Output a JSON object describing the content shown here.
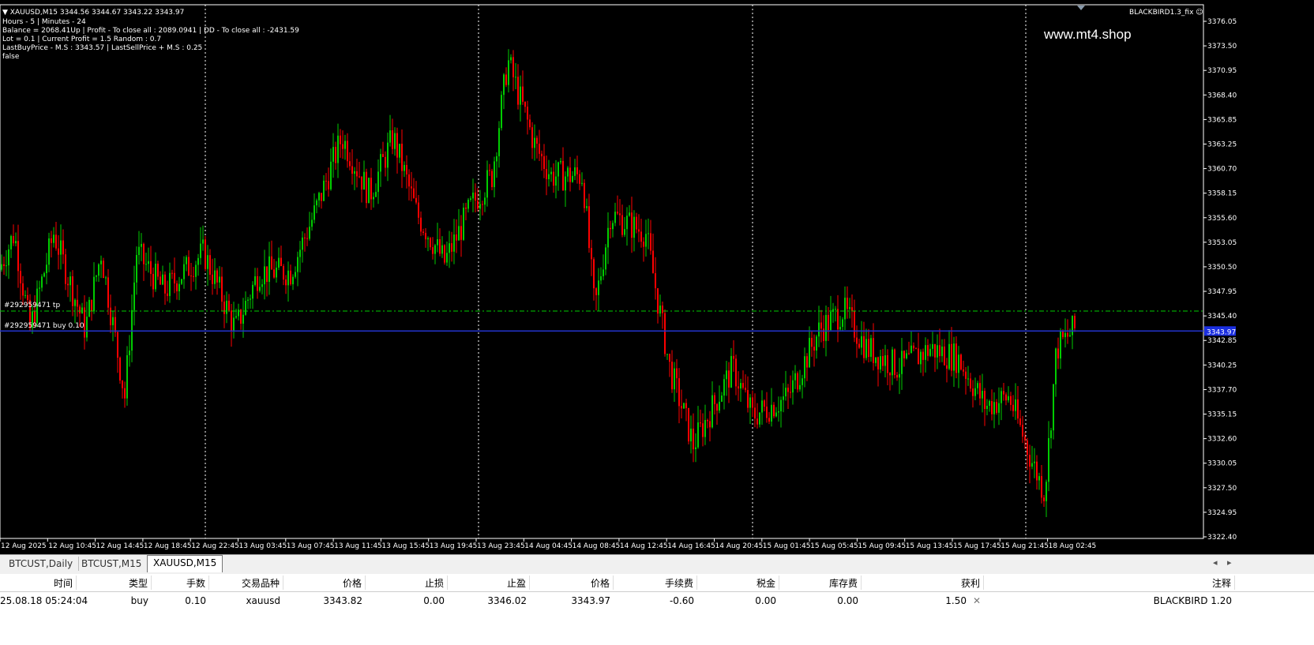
{
  "chart": {
    "header": "XAUUSD,M15  3344.56 3344.67 3343.22 3343.97",
    "info_lines": [
      "Hours - 5 | Minutes - 24",
      "Balance = 2068.41Up | Profit - To close all : 2089.0941 | DD - To close all : -2431.59",
      "Lot = 0.1 | Current Profit = 1.5 Random : 0.7",
      "LastBuyPrice - M.S : 3343.57 | LastSellPrice + M.S : 0.25",
      "false"
    ],
    "ea_name": "BLACKBIRD1.3_fix",
    "watermark": "www.mt4.shop",
    "tp_label": "#292959471 tp",
    "buy_label": "#292959471 buy 0.10",
    "current_price_label": "3343.97",
    "tp_price": 3345.9,
    "buy_price": 3343.82,
    "colors": {
      "bull": "#00cc00",
      "bear": "#ff0000",
      "background": "#000000",
      "buy_line": "#2233cc",
      "tp_line": "#00cc00"
    }
  },
  "price_axis": {
    "ticks": [
      "3376.05",
      "3373.50",
      "3370.95",
      "3368.40",
      "3365.85",
      "3363.25",
      "3360.70",
      "3358.15",
      "3355.60",
      "3353.05",
      "3350.50",
      "3347.95",
      "3345.40",
      "3342.85",
      "3340.25",
      "3337.70",
      "3335.15",
      "3332.60",
      "3330.05",
      "3327.50",
      "3324.95",
      "3322.40"
    ]
  },
  "time_axis": {
    "ticks": [
      "12 Aug 2025",
      "12 Aug 10:45",
      "12 Aug 14:45",
      "12 Aug 18:45",
      "12 Aug 22:45",
      "13 Aug 03:45",
      "13 Aug 07:45",
      "13 Aug 11:45",
      "13 Aug 15:45",
      "13 Aug 19:45",
      "13 Aug 23:45",
      "14 Aug 04:45",
      "14 Aug 08:45",
      "14 Aug 12:45",
      "14 Aug 16:45",
      "14 Aug 20:45",
      "15 Aug 01:45",
      "15 Aug 05:45",
      "15 Aug 09:45",
      "15 Aug 13:45",
      "15 Aug 17:45",
      "15 Aug 21:45",
      "18 Aug 02:45"
    ]
  },
  "tabs": [
    "BTCUST,Daily",
    "BTCUST,M15",
    "XAUUSD,M15"
  ],
  "active_tab": 2,
  "trade_table": {
    "headers": [
      "时间",
      "类型",
      "手数",
      "交易品种",
      "价格",
      "止损",
      "止盈",
      "价格",
      "手续费",
      "税金",
      "库存费",
      "获利",
      "注释"
    ],
    "row": [
      "25.08.18 05:24:04",
      "buy",
      "0.10",
      "xauusd",
      "3343.82",
      "0.00",
      "3346.02",
      "3343.97",
      "-0.60",
      "0.00",
      "0.00",
      "1.50",
      "BLACKBIRD 1.20"
    ]
  }
}
